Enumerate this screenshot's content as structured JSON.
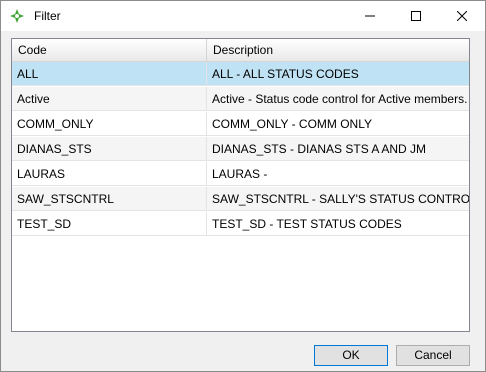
{
  "window": {
    "title": "Filter"
  },
  "grid": {
    "columns": [
      "Code",
      "Description"
    ],
    "rows": [
      {
        "code": "ALL",
        "description": "ALL - ALL STATUS CODES",
        "selected": true
      },
      {
        "code": "Active",
        "description": "Active - Status code control for Active members.",
        "selected": false
      },
      {
        "code": "COMM_ONLY",
        "description": "COMM_ONLY - COMM ONLY",
        "selected": false
      },
      {
        "code": "DIANAS_STS",
        "description": "DIANAS_STS - DIANAS STS A AND JM",
        "selected": false
      },
      {
        "code": "LAURAS",
        "description": "LAURAS -",
        "selected": false
      },
      {
        "code": "SAW_STSCNTRL",
        "description": "SAW_STSCNTRL - SALLY'S STATUS CONTROL",
        "selected": false
      },
      {
        "code": "TEST_SD",
        "description": "TEST_SD - TEST STATUS CODES",
        "selected": false
      }
    ]
  },
  "buttons": {
    "ok": "OK",
    "cancel": "Cancel"
  },
  "colors": {
    "selected_row": "#bfe2f5",
    "alt_row": "#f5f5f5",
    "app_icon": "#3fa535"
  }
}
